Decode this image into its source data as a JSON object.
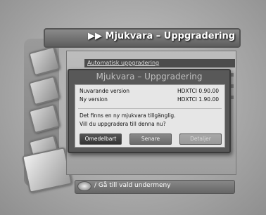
{
  "menu": {
    "title": "Mjukvara – Uppgradering",
    "title_glyph": "▶▶",
    "selected_item": "Automatisk uppgradering"
  },
  "dialog": {
    "title": "Mjukvara – Uppgradering",
    "current_version_label": "Nuvarande version",
    "current_version_value": "HDXTCI  0.90.00",
    "new_version_label": "Ny version",
    "new_version_value": "HDXTCI  1.90.00",
    "message_line1": "Det finns en ny mjukvara tillgänglig.",
    "message_line2": "Vill du uppgradera till denna nu?",
    "buttons": {
      "now": "Omedelbart",
      "later": "Senare",
      "details": "Detaljer"
    }
  },
  "footer": {
    "hint": "/ Gå till vald undermeny",
    "icon": "ok-button-icon"
  }
}
